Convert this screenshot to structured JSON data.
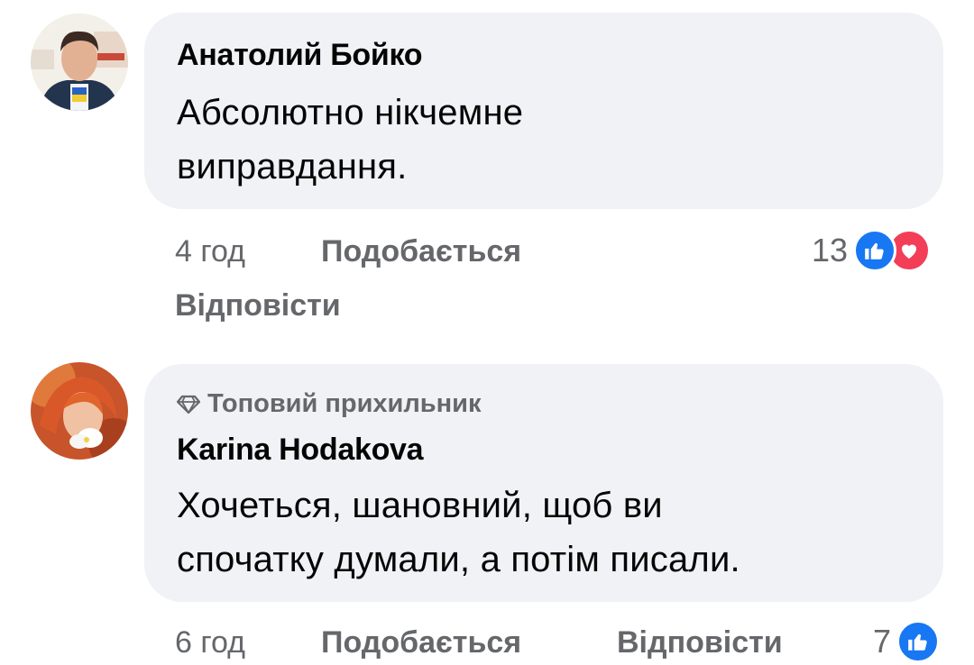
{
  "comments": [
    {
      "author": "Анатолий Бойко",
      "text_lines": [
        "Абсолютно нікчемне",
        "виправдання."
      ],
      "time": "4 год",
      "like_label": "Подобається",
      "reply_label": "Відповісти",
      "reaction_count": "13",
      "reactions": [
        "like-icon",
        "love-icon"
      ]
    },
    {
      "badge": "Топовий прихильник",
      "badge_icon": "diamond-icon",
      "author": "Karina Hodakova",
      "text_lines": [
        "Хочеться, шановний, щоб ви",
        "спочатку думали, а потім писали."
      ],
      "time": "6 год",
      "like_label": "Подобається",
      "reply_label": "Відповісти",
      "reaction_count": "7",
      "reactions": [
        "like-icon"
      ]
    }
  ],
  "colors": {
    "bubble": "#f0f2f5",
    "meta_text": "#65676b",
    "like_blue": "#1877f2",
    "love_red": "#f33e58"
  }
}
